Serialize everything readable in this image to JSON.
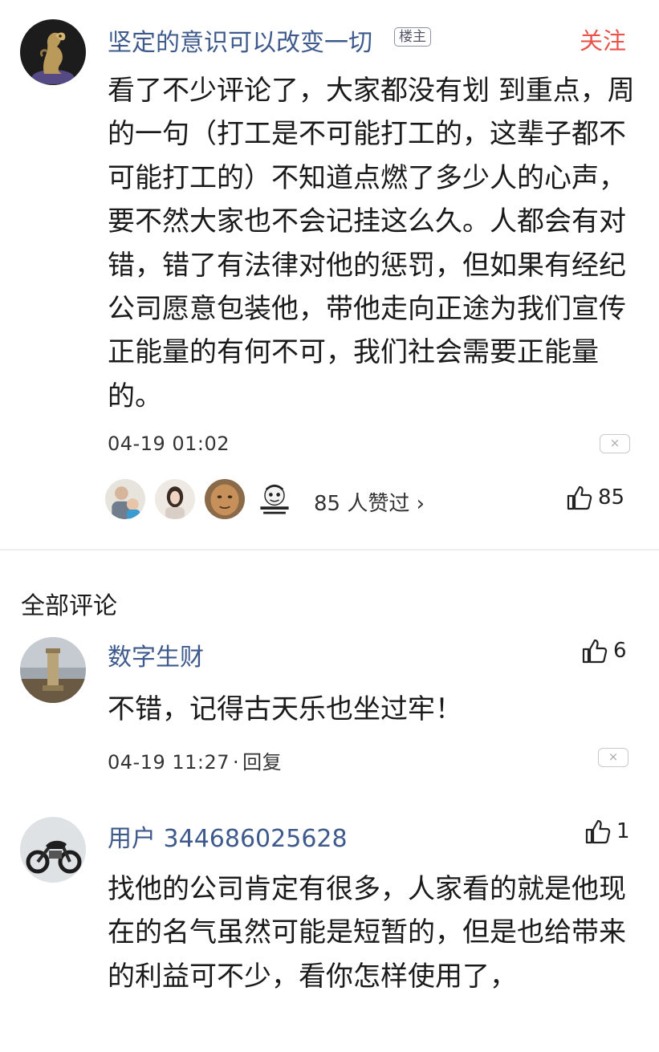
{
  "main_comment": {
    "author": "坚定的意识可以改变一切",
    "badge": "楼主",
    "follow_label": "关注",
    "content": "看了不少评论了，大家都没有划 到重点，周的一句（打工是不可能打工的，这辈子都不可能打工的）不知道点燃了多少人的心声，要不然大家也不会记挂这么久。人都会有对错，错了有法律对他的惩罚，但如果有经纪公司愿意包装他，带他走向正途为我们宣传正能量的有何不可，我们社会需要正能量的。",
    "timestamp": "04-19 01:02",
    "close_icon": "×",
    "likers_text": "85 人赞过 ›",
    "like_count": "85"
  },
  "section": {
    "title": "全部评论"
  },
  "comments": [
    {
      "author": "数字生财",
      "content": "不错，记得古天乐也坐过牢！",
      "timestamp": "04-19 11:27",
      "separator": "·",
      "reply_label": "回复",
      "like_count": "6",
      "close_icon": "×"
    },
    {
      "author": "用户 344686025628",
      "content": "找他的公司肯定有很多，人家看的就是他现在的名气虽然可能是短暂的，但是也给带来的利益可不少，看你怎样使用了，",
      "like_count": "1"
    }
  ],
  "icons": {
    "like": "thumbs-up-icon",
    "close": "close-icon"
  },
  "colors": {
    "name": "#3e5a8c",
    "follow": "#e8534c",
    "text": "#1a1a1a"
  }
}
